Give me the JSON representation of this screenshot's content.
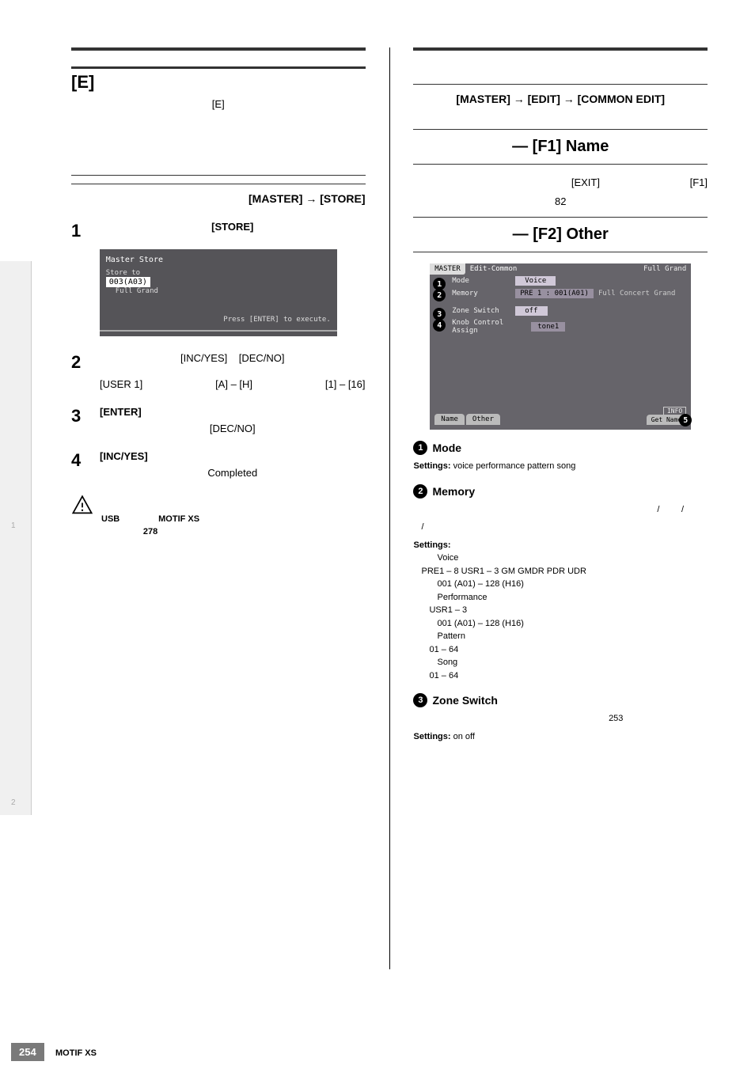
{
  "footer": {
    "page": "254",
    "product": "MOTIF XS"
  },
  "side": {
    "t1": "1",
    "t2": "2"
  },
  "left": {
    "section_letter": "[E]",
    "p1": "[E]",
    "breadcrumb": "[MASTER] → [STORE]",
    "step1_num": "1",
    "step1_text": "[STORE]",
    "lcd": {
      "title": "Master Store",
      "store_to": "Store to",
      "num": "003(A03)",
      "name": "Full Grand",
      "exec": "Press [ENTER] to execute."
    },
    "step2_num": "2",
    "step2_a": "[INC/YES]",
    "step2_b": "[DEC/NO]",
    "step2_c": "[USER 1]",
    "step2_d": "[A] – [H]",
    "step2_e": "[1] – [16]",
    "step3_num": "3",
    "step3_a": "[ENTER]",
    "step3_b": "[DEC/NO]",
    "step4_num": "4",
    "step4_a": "[INC/YES]",
    "step4_b": "Completed",
    "warn_usb": "USB",
    "warn_model": "MOTIF XS",
    "warn_page": "278"
  },
  "right": {
    "breadcrumb": "[MASTER] → [EDIT] → [COMMON EDIT]",
    "f1_title": "— [F1] Name",
    "f1_exit": "[EXIT]",
    "f1_key": "[F1]",
    "f1_82": "82",
    "f2_title": "— [F2] Other",
    "lcd2": {
      "tab": "MASTER",
      "crumb": "Edit-Common",
      "right": "Full Grand",
      "r1_lbl": "Mode",
      "r1_val": "Voice",
      "r2_lbl": "Memory",
      "r2_val": "PRE 1 : 001(A01)",
      "r2_rest": "Full Concert Grand",
      "r3_lbl": "Zone Switch",
      "r3_val": "off",
      "r4_lbl": "Knob Control Assign",
      "r4_val": "tone1",
      "bt1": "Name",
      "bt2": "Other",
      "info": "INFO",
      "get": "Get Name"
    },
    "p1_num": "1",
    "p1_label": "Mode",
    "p1_settings": "Settings:",
    "p1_vals": "voice    performance    pattern    song",
    "p2_num": "2",
    "p2_label": "Memory",
    "p2_sl1": "/",
    "p2_sl2": "/",
    "p2_sl3": "/",
    "p2_settings": "Settings:",
    "p2_v1": "Voice",
    "p2_v1a": "PRE1 – 8    USR1 – 3    GM    GMDR    PDR    UDR",
    "p2_v1b": "001 (A01) – 128 (H16)",
    "p2_v2": "Performance",
    "p2_v2a": "USR1 – 3",
    "p2_v2b": "001 (A01) – 128 (H16)",
    "p2_v3": "Pattern",
    "p2_v3a": "01 – 64",
    "p2_v4": "Song",
    "p2_v4a": "01 – 64",
    "p3_num": "3",
    "p3_label": "Zone Switch",
    "p3_253": "253",
    "p3_settings": "Settings:",
    "p3_vals": "on    off",
    "c1": "1",
    "c2": "2",
    "c3": "3",
    "c4": "4",
    "c5": "5"
  }
}
